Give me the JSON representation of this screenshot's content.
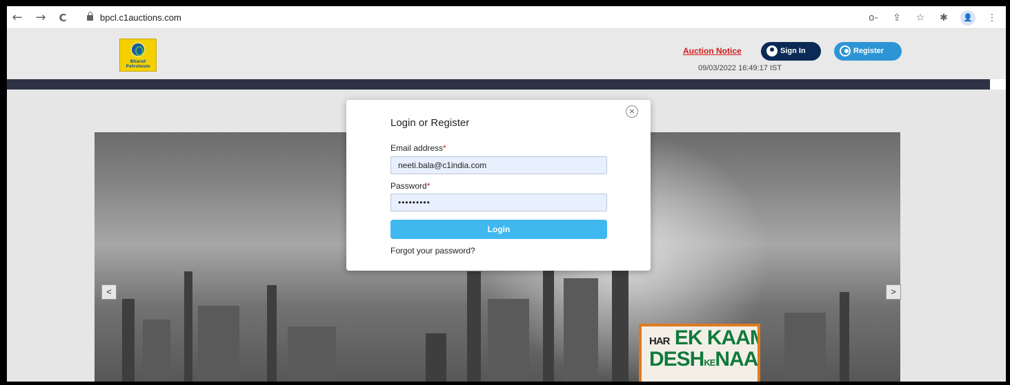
{
  "browser": {
    "back_icon": "←",
    "forward_icon": "→",
    "reload_icon": "C",
    "url": "bpcl.c1auctions.com",
    "icons": [
      "key-icon",
      "share-icon",
      "star-icon",
      "extensions-icon",
      "profile-icon",
      "menu-icon"
    ],
    "icon_glyphs": {
      "key": "o-",
      "share": "⇪",
      "star": "☆",
      "ext": "✱",
      "profile": "👤",
      "menu": "⋮"
    }
  },
  "header": {
    "logo_text": "Bharat Petroleum",
    "auction_notice": "Auction Notice",
    "sign_in": "Sign In",
    "register": "Register",
    "datetime": "09/03/2022 16:49:17 IST"
  },
  "slider": {
    "prev": "<",
    "next": ">",
    "banner_line1_big1": "HAR",
    "banner_line1_big2": "EK KAAM",
    "banner_line2_big1": "DESH",
    "banner_line2_small": "KE",
    "banner_line2_big2": "NAAM"
  },
  "modal": {
    "close": "×",
    "title": "Login or Register",
    "email_label": "Email address",
    "required_mark": "*",
    "email_value": "neeti.bala@c1india.com",
    "password_label": "Password",
    "password_value": "•••••••••",
    "login_button": "Login",
    "forgot_link": "Forgot your password?"
  },
  "colors": {
    "signin_bg": "#0b2a55",
    "register_bg": "#2d95d6",
    "login_bg": "#3fb8f0",
    "notice_red": "#d11a1a",
    "band": "#2d3345"
  }
}
